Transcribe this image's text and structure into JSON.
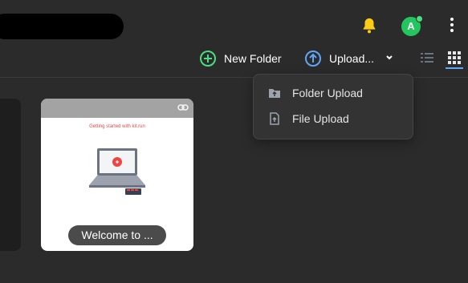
{
  "header": {
    "avatar_letter": "A",
    "bell_icon": "bell-icon",
    "menu_icon": "kebab-icon"
  },
  "toolbar": {
    "new_folder_label": "New Folder",
    "upload_label": "Upload...",
    "list_view_icon": "list-view-icon",
    "grid_view_icon": "grid-view-icon"
  },
  "upload_menu": {
    "items": [
      {
        "label": "Folder Upload",
        "icon": "folder-upload-icon"
      },
      {
        "label": "File Upload",
        "icon": "file-upload-icon"
      }
    ]
  },
  "files": [
    {
      "thumb_text": "Getting started with kit.run",
      "caption": "Welcome to ..."
    }
  ],
  "colors": {
    "background": "#2b2b2b",
    "accent_green": "#4ade80",
    "accent_blue": "#60a5fa",
    "bell": "#facc15"
  }
}
